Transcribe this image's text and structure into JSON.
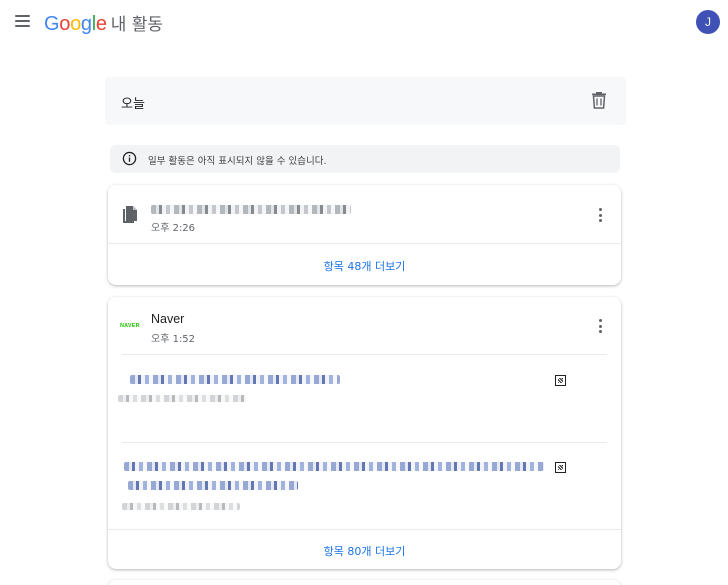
{
  "header": {
    "logo_letters": [
      {
        "ch": "G",
        "color": "#4285F4"
      },
      {
        "ch": "o",
        "color": "#EA4335"
      },
      {
        "ch": "o",
        "color": "#FBBC05"
      },
      {
        "ch": "g",
        "color": "#4285F4"
      },
      {
        "ch": "l",
        "color": "#34A853"
      },
      {
        "ch": "e",
        "color": "#EA4335"
      }
    ],
    "product_name": "내 활동",
    "avatar_initial": "J",
    "avatar_color": "#3f51b5",
    "menu_icon": "hamburger-menu-icon"
  },
  "day": {
    "title": "오늘",
    "delete_icon": "trash-icon"
  },
  "info_banner": {
    "icon": "info-icon",
    "text": "일부 활동은 아직 표시되지 않을 수 있습니다."
  },
  "cards": [
    {
      "icon": "document-icon",
      "time": "오후 2:26",
      "more_label": "항목 48개 더보기"
    },
    {
      "logo_text": "NAVER",
      "logo_color": "#1ec800",
      "site_name": "Naver",
      "time": "오후 1:52",
      "more_label": "항목 80개 더보기"
    }
  ],
  "link_color": "#1a73e8"
}
